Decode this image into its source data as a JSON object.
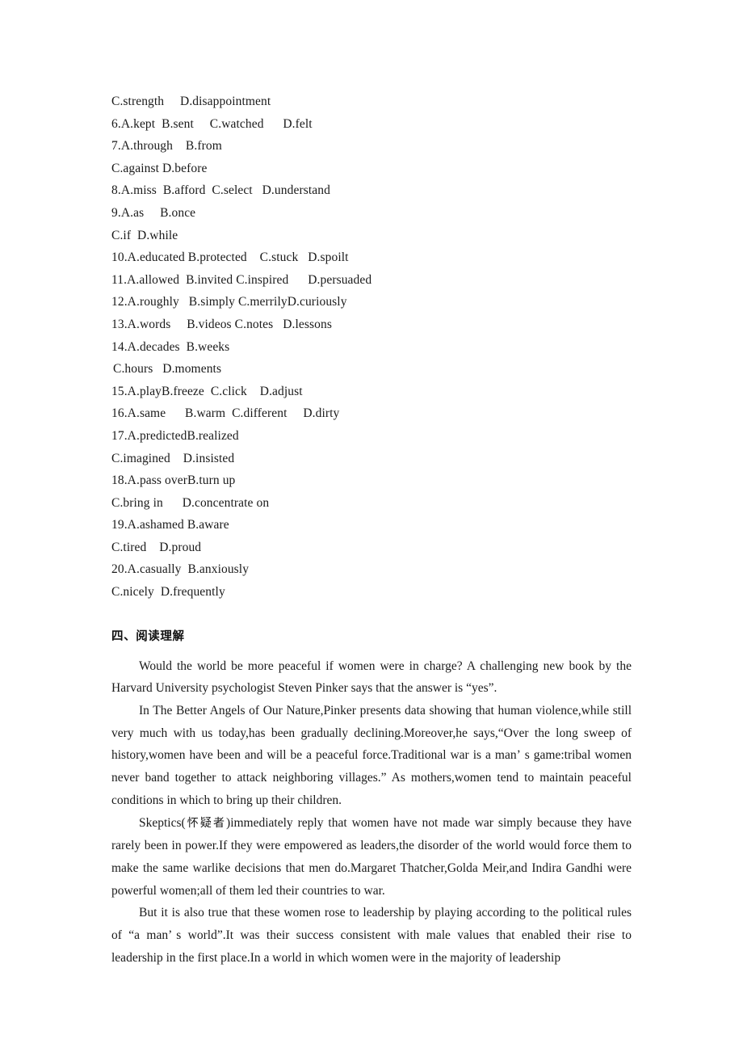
{
  "document": {
    "type": "english-exam-worksheet",
    "background_color": "#ffffff",
    "text_color": "#1a1a1a"
  },
  "cloze_options": {
    "lines": [
      {
        "id": "opt-5-cd",
        "text": "C.strength     D.disappointment"
      },
      {
        "id": "opt-6",
        "text": "6.A.kept  B.sent     C.watched      D.felt"
      },
      {
        "id": "opt-7-ab",
        "text": "7.A.through    B.from"
      },
      {
        "id": "opt-7-cd",
        "text": "C.against D.before"
      },
      {
        "id": "opt-8",
        "text": "8.A.miss  B.afford  C.select   D.understand"
      },
      {
        "id": "opt-9-ab",
        "text": "9.A.as     B.once"
      },
      {
        "id": "opt-9-cd",
        "text": "C.if  D.while"
      },
      {
        "id": "opt-10",
        "text": "10.A.educated B.protected    C.stuck   D.spoilt"
      },
      {
        "id": "opt-11",
        "text": "11.A.allowed  B.invited C.inspired      D.persuaded"
      },
      {
        "id": "opt-12",
        "text": "12.A.roughly   B.simply C.merrilyD.curiously"
      },
      {
        "id": "opt-13",
        "text": "13.A.words     B.videos C.notes   D.lessons"
      },
      {
        "id": "opt-14-ab",
        "text": "14.A.decades  B.weeks"
      },
      {
        "id": "opt-14-cd",
        "text": "C.hours   D.moments",
        "indent": true
      },
      {
        "id": "opt-15",
        "text": "15.A.playB.freeze  C.click    D.adjust"
      },
      {
        "id": "opt-16",
        "text": "16.A.same      B.warm  C.different     D.dirty"
      },
      {
        "id": "opt-17-ab",
        "text": "17.A.predictedB.realized"
      },
      {
        "id": "opt-17-cd",
        "text": "C.imagined    D.insisted"
      },
      {
        "id": "opt-18-ab",
        "text": "18.A.pass overB.turn up"
      },
      {
        "id": "opt-18-cd",
        "text": "C.bring in      D.concentrate on"
      },
      {
        "id": "opt-19-ab",
        "text": "19.A.ashamed B.aware"
      },
      {
        "id": "opt-19-cd",
        "text": "C.tired    D.proud"
      },
      {
        "id": "opt-20-ab",
        "text": "20.A.casually  B.anxiously"
      },
      {
        "id": "opt-20-cd",
        "text": "C.nicely  D.frequently"
      }
    ]
  },
  "reading_section": {
    "heading": "四、阅读理解",
    "paragraphs": [
      {
        "id": "para-1",
        "text": "Would the world be more peaceful if women were in charge? A challenging new book by the Harvard University psychologist Steven Pinker says that the answer is “yes”."
      },
      {
        "id": "para-2",
        "segments": [
          {
            "type": "text",
            "value": "In The Better Angels of Our Nature,Pinker presents data showing that human violence,while still very much with us today,has been gradually declining.Moreover,he says,“Over the long sweep of history,women have been and will be a peaceful force.Traditional war is a man"
          },
          {
            "type": "apostrophe",
            "value": "’"
          },
          {
            "type": "text",
            "value": "s game:tribal women never band together to attack neighboring villages.” As mothers,women tend to maintain peaceful conditions in which to bring up their children."
          }
        ]
      },
      {
        "id": "para-3",
        "segments": [
          {
            "type": "text",
            "value": "Skeptics("
          },
          {
            "type": "gloss",
            "value": "怀疑者"
          },
          {
            "type": "text",
            "value": ")immediately reply that women have not made war simply because they have rarely been in power.If they were empowered as leaders,the disorder of the world would force them to make the same warlike decisions that men do.Margaret Thatcher,Golda Meir,and Indira Gandhi were powerful women;all of them led their countries to war."
          }
        ]
      },
      {
        "id": "para-4",
        "segments": [
          {
            "type": "text",
            "value": "But it is also true that these women rose to leadership by playing according to the political rules of “a man"
          },
          {
            "type": "apostrophe",
            "value": "’"
          },
          {
            "type": "text",
            "value": "s world”.It was their success consistent with male values that enabled their rise to leadership in the first place.In a world in which women were in the majority of leadership"
          }
        ]
      }
    ]
  }
}
